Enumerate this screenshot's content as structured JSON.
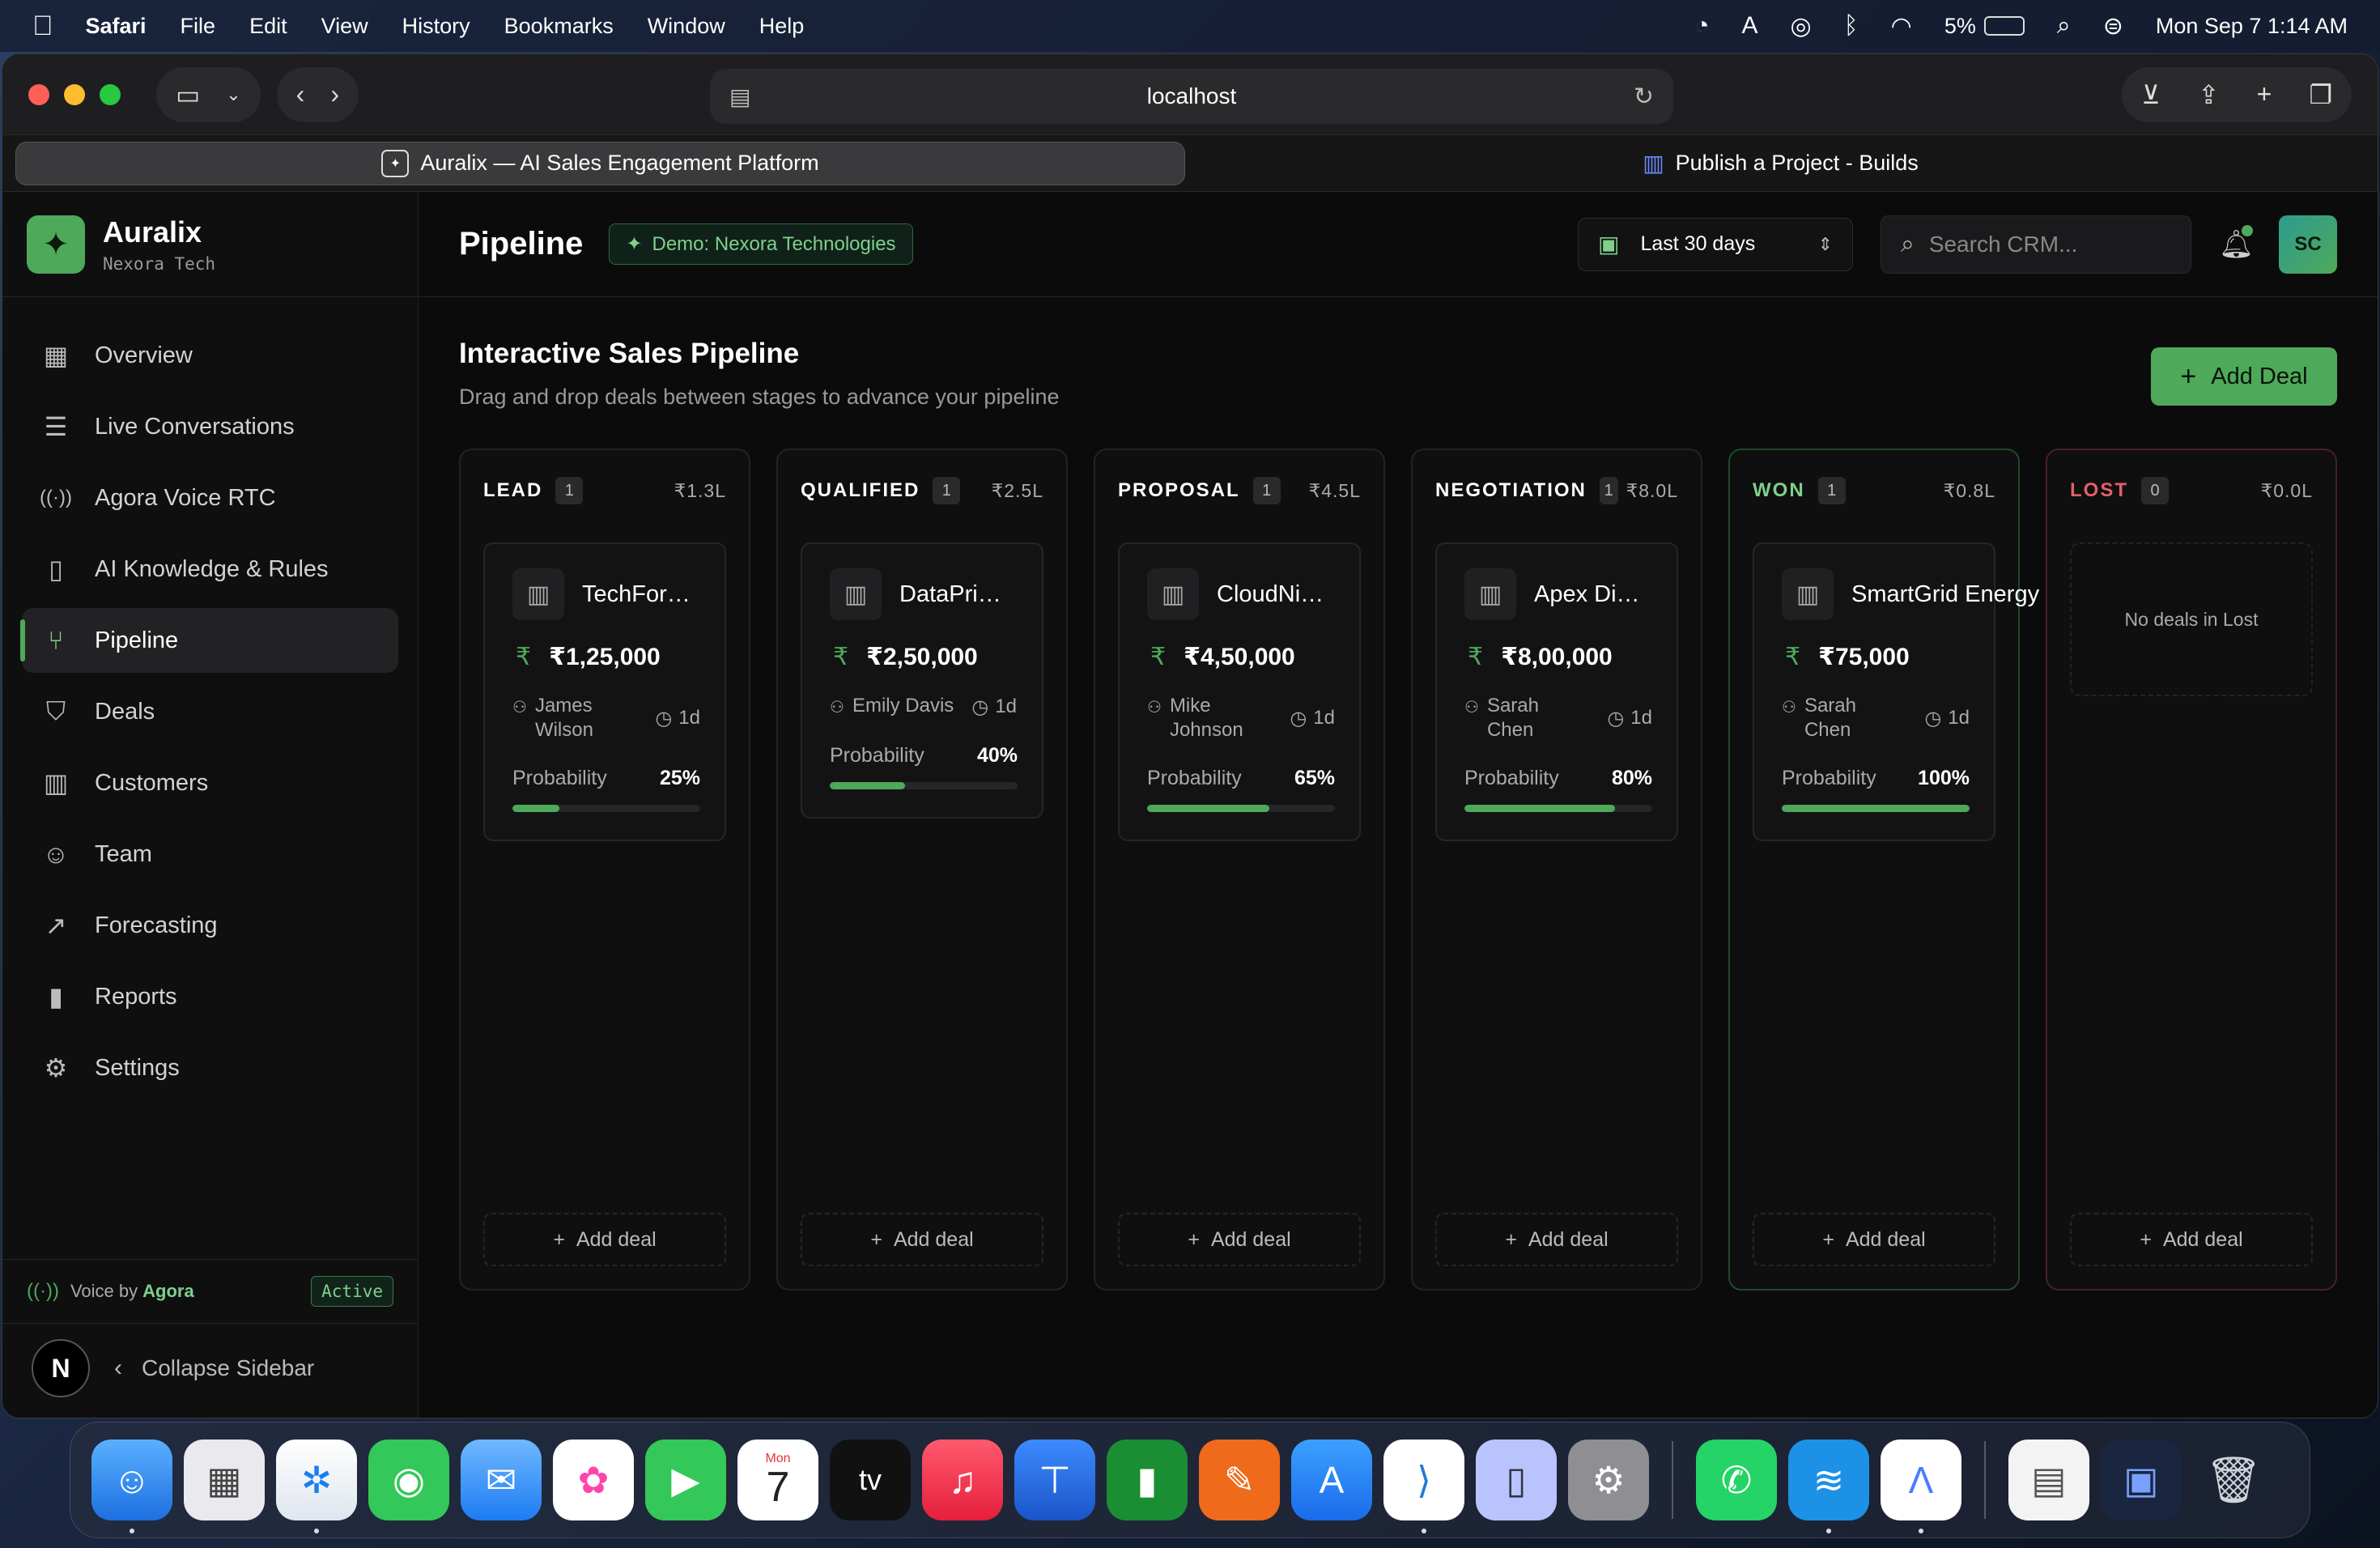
{
  "menubar": {
    "apple": "",
    "app": "Safari",
    "items": [
      "File",
      "Edit",
      "View",
      "History",
      "Bookmarks",
      "Window",
      "Help"
    ],
    "battery": "5%",
    "datetime": "Mon Sep 7  1:14 AM"
  },
  "browser": {
    "address": "localhost",
    "tabs": [
      {
        "label": "Auralix — AI Sales Engagement Platform"
      },
      {
        "label": "Publish a Project - Builds"
      }
    ]
  },
  "sidebar": {
    "brand": "Auralix",
    "sub": "Nexora Tech",
    "items": [
      {
        "label": "Overview",
        "icon": "grid-icon",
        "glyph": "▦"
      },
      {
        "label": "Live Conversations",
        "icon": "message-icon",
        "glyph": "☰"
      },
      {
        "label": "Agora Voice RTC",
        "icon": "broadcast-icon",
        "glyph": "((·))"
      },
      {
        "label": "AI Knowledge & Rules",
        "icon": "book-icon",
        "glyph": "📖"
      },
      {
        "label": "Pipeline",
        "icon": "git-branch-icon",
        "glyph": "⑂"
      },
      {
        "label": "Deals",
        "icon": "handshake-icon",
        "glyph": "⛉"
      },
      {
        "label": "Customers",
        "icon": "building-icon",
        "glyph": "▥"
      },
      {
        "label": "Team",
        "icon": "users-icon",
        "glyph": "👥"
      },
      {
        "label": "Forecasting",
        "icon": "trending-up-icon",
        "glyph": "↗"
      },
      {
        "label": "Reports",
        "icon": "bar-chart-icon",
        "glyph": "▮"
      },
      {
        "label": "Settings",
        "icon": "gear-icon",
        "glyph": "⚙"
      }
    ],
    "voice_prefix": "Voice by",
    "voice_brand": "Agora",
    "voice_status": "Active",
    "avatar_letter": "N",
    "collapse_label": "Collapse Sidebar"
  },
  "header": {
    "title": "Pipeline",
    "demo_badge": "Demo: Nexora Technologies",
    "date_range": "Last 30 days",
    "search_placeholder": "Search CRM...",
    "avatar": "SC"
  },
  "section": {
    "title": "Interactive Sales Pipeline",
    "subtitle": "Drag and drop deals between stages to advance your pipeline",
    "add_button": "Add Deal"
  },
  "stages": [
    {
      "name": "LEAD",
      "count": "1",
      "total": "₹1.3L"
    },
    {
      "name": "QUALIFIED",
      "count": "1",
      "total": "₹2.5L"
    },
    {
      "name": "PROPOSAL",
      "count": "1",
      "total": "₹4.5L"
    },
    {
      "name": "NEGOTIATION",
      "count": "1",
      "total": "₹8.0L"
    },
    {
      "name": "WON",
      "count": "1",
      "total": "₹0.8L"
    },
    {
      "name": "LOST",
      "count": "0",
      "total": "₹0.0L",
      "empty": "No deals in Lost"
    }
  ],
  "deals": [
    {
      "name": "TechForward Ba...",
      "amount": "₹1,25,000",
      "owner": "James Wilson",
      "owner_l1": "James",
      "owner_l2": "Wilson",
      "age": "1d",
      "prob_label": "Probability",
      "probability": "25%",
      "prob_value": 25
    },
    {
      "name": "DataPrime Anal...",
      "amount": "₹2,50,000",
      "owner": "Emily Davis",
      "age": "1d",
      "prob_label": "Probability",
      "probability": "40%",
      "prob_value": 40
    },
    {
      "name": "CloudNine Tech...",
      "amount": "₹4,50,000",
      "owner": "Mike Johnson",
      "owner_l1": "Mike",
      "owner_l2": "Johnson",
      "age": "1d",
      "prob_label": "Probability",
      "probability": "65%",
      "prob_value": 65
    },
    {
      "name": "Apex Digital Sol...",
      "amount": "₹8,00,000",
      "owner": "Sarah Chen",
      "age": "1d",
      "prob_label": "Probability",
      "probability": "80%",
      "prob_value": 80
    },
    {
      "name": "SmartGrid Energy",
      "amount": "₹75,000",
      "owner": "Sarah Chen",
      "age": "1d",
      "prob_label": "Probability",
      "probability": "100%",
      "prob_value": 100
    }
  ],
  "column_add_label": "Add deal",
  "colors": {
    "accent": "#4ea95a",
    "won": "#7fd08b",
    "lost": "#e0606b"
  },
  "dock": {
    "calendar_month": "Mon",
    "calendar_day": "7",
    "tv_label": "tv"
  }
}
